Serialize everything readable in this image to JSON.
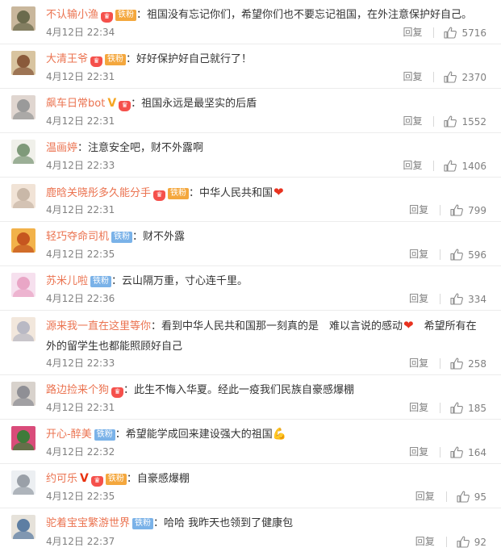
{
  "colors": {
    "username": "#eb7350",
    "meta": "#808080",
    "fan_badge": "#7ab2e8",
    "vip_badge": "#f4a73d"
  },
  "comments": [
    {
      "user": "不认输小渔",
      "badge": "铁粉",
      "text": "：祖国没有忘记你们，希望你们也不要忘记祖国，在外注意保护好自己。",
      "time": "4月12日 22:34",
      "reply": "回复",
      "likes": "5716"
    },
    {
      "user": "大清王爷",
      "badge": "铁粉",
      "text": "：好好保护好自己就行了！",
      "time": "4月12日 22:31",
      "reply": "回复",
      "likes": "2370"
    },
    {
      "user": "飙车日常bot",
      "badge": "",
      "text": "：祖国永远是最坚实的后盾",
      "time": "4月12日 22:31",
      "reply": "回复",
      "likes": "1552"
    },
    {
      "user": "温画婷",
      "badge": "",
      "text": "：注意安全吧，财不外露啊",
      "time": "4月12日 22:33",
      "reply": "回复",
      "likes": "1406"
    },
    {
      "user": "鹿晗关晓彤多久能分手",
      "badge": "铁粉",
      "text": "：中华人民共和国",
      "time": "4月12日 22:31",
      "reply": "回复",
      "likes": "799"
    },
    {
      "user": "轻巧夺命司机",
      "badge": "铁粉",
      "text": "：财不外露",
      "time": "4月12日 22:35",
      "reply": "回复",
      "likes": "596"
    },
    {
      "user": "苏米儿啦",
      "badge": "铁粉",
      "text": "：云山隔万重，寸心连千里。",
      "time": "4月12日 22:36",
      "reply": "回复",
      "likes": "334"
    },
    {
      "user": "源来我一直在这里等你",
      "badge": "",
      "text_a": "：看到中华人民共和国那一刻真的是　难以言说的感动",
      "text_b": "　希望所有在外的留学生也都能照顾好自己",
      "time": "4月12日 22:33",
      "reply": "回复",
      "likes": "258"
    },
    {
      "user": "路边捡来个狗",
      "badge": "",
      "text": "：此生不悔入华夏。经此一疫我们民族自豪感爆棚",
      "time": "4月12日 22:31",
      "reply": "回复",
      "likes": "185"
    },
    {
      "user": "开心-醉美",
      "badge": "铁粉",
      "text": "：希望能学成回来建设强大的祖国",
      "time": "4月12日 22:32",
      "reply": "回复",
      "likes": "164"
    },
    {
      "user": "约可乐",
      "badge": "铁粉",
      "text": "：自豪感爆棚",
      "time": "4月12日 22:35",
      "reply": "回复",
      "likes": "95"
    },
    {
      "user": "驼着宝宝繁游世界",
      "badge": "铁粉",
      "text": "：哈哈 我昨天也领到了健康包",
      "time": "4月12日 22:37",
      "reply": "回复",
      "likes": "92"
    }
  ]
}
